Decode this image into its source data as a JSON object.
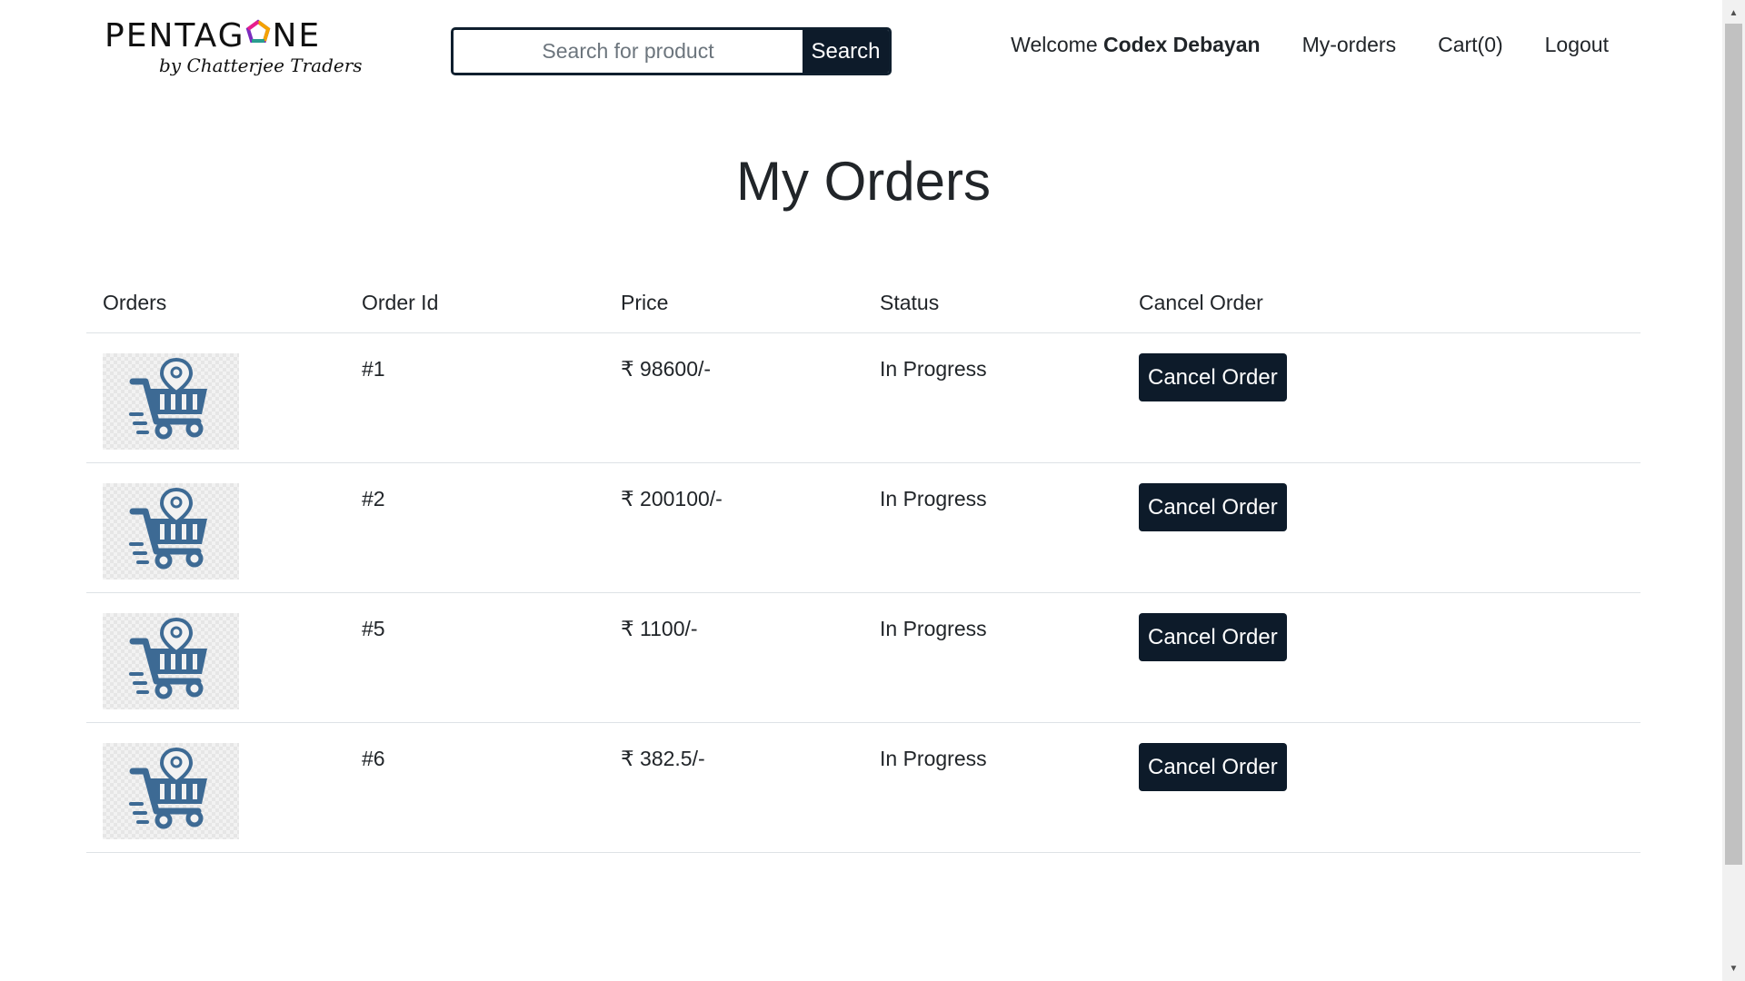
{
  "header": {
    "logo_text": "PENTAGONE",
    "logo_tagline": "by Chatterjee Traders",
    "search_placeholder": "Search for product",
    "search_button": "Search",
    "welcome_prefix": "Welcome ",
    "user_name": "Codex Debayan",
    "nav_my_orders": "My-orders",
    "nav_cart": "Cart(0)",
    "nav_logout": "Logout"
  },
  "page_title": "My Orders",
  "table": {
    "headers": [
      "Orders",
      "Order Id",
      "Price",
      "Status",
      "Cancel Order"
    ],
    "rows": [
      {
        "image_icon": "shopping-cart-icon",
        "order_id": "#1",
        "price": "₹ 98600/-",
        "status": "In Progress",
        "action": "Cancel Order"
      },
      {
        "image_icon": "shopping-cart-icon",
        "order_id": "#2",
        "price": "₹ 200100/-",
        "status": "In Progress",
        "action": "Cancel Order"
      },
      {
        "image_icon": "shopping-cart-icon",
        "order_id": "#5",
        "price": "₹ 1100/-",
        "status": "In Progress",
        "action": "Cancel Order"
      },
      {
        "image_icon": "shopping-cart-icon",
        "order_id": "#6",
        "price": "₹ 382.5/-",
        "status": "In Progress",
        "action": "Cancel Order"
      }
    ]
  },
  "colors": {
    "button_bg": "#0d1b2a",
    "cart_icon": "#3d6a94",
    "logo_accent": [
      "#e63946",
      "#f4a300",
      "#2a9d8f",
      "#7b2cbf",
      "#e91e8c"
    ]
  }
}
